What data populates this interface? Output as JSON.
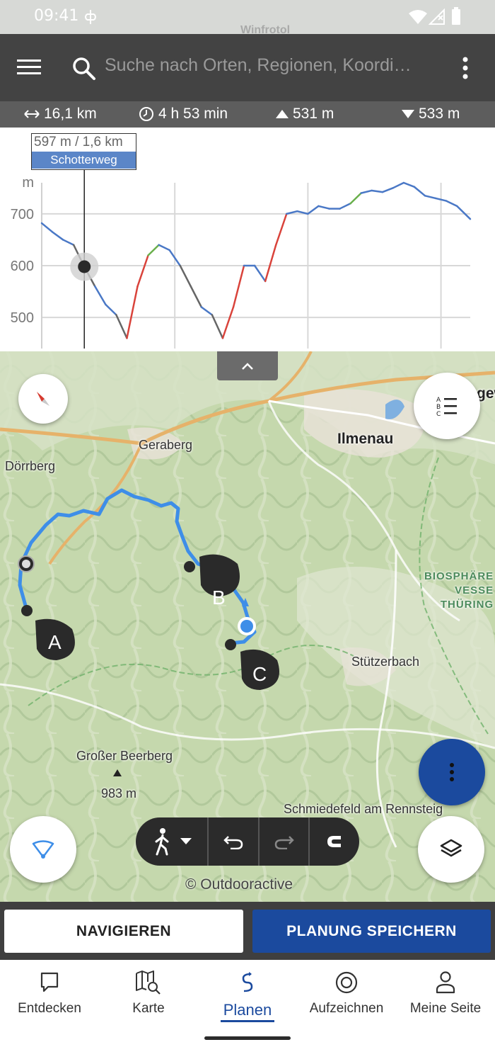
{
  "status_bar": {
    "time": "09:41",
    "behind_text": "Winfrotol"
  },
  "search": {
    "placeholder": "Suche nach Orten, Regionen, Koordi…"
  },
  "stats": {
    "distance": "16,1 km",
    "duration": "4 h 53 min",
    "ascent": "531 m",
    "descent": "533 m"
  },
  "chart_data": {
    "type": "line",
    "ylabel": "m",
    "yticks": [
      500,
      600,
      700
    ],
    "ylim": [
      440,
      760
    ],
    "x": [
      0,
      0.4,
      0.8,
      1.2,
      1.6,
      2.0,
      2.4,
      2.8,
      3.2,
      3.6,
      4.0,
      4.4,
      4.8,
      5.2,
      5.6,
      6.0,
      6.4,
      6.8,
      7.2,
      7.6,
      8.0,
      8.4,
      8.8,
      9.2,
      9.6,
      10.0,
      10.4,
      10.8,
      11.2,
      11.6,
      12.0,
      12.4,
      12.8,
      13.2,
      13.6,
      14.0,
      14.4,
      14.8,
      15.2,
      15.6,
      16.1
    ],
    "values": [
      682,
      665,
      650,
      640,
      598,
      560,
      525,
      505,
      460,
      560,
      620,
      640,
      630,
      600,
      560,
      520,
      505,
      460,
      520,
      600,
      600,
      570,
      640,
      700,
      705,
      700,
      715,
      710,
      710,
      720,
      740,
      745,
      742,
      750,
      760,
      752,
      735,
      730,
      725,
      715,
      690
    ],
    "tooltip": {
      "value": "597 m / 1,6 km",
      "surface": "Schotterweg"
    },
    "cursor_km": 1.6,
    "colors": {
      "default": "#4a78c6",
      "uphill": "#6ab04c",
      "steep": "#d9433b",
      "downhill": "#666666"
    }
  },
  "map": {
    "places": [
      "Geraberg",
      "Ilmenau",
      "Dörrberg",
      "Stützerbach",
      "Großer Beerberg",
      "983 m",
      "Schmiedefeld am Rennsteig"
    ],
    "region": [
      "BIOSPHÄRE",
      "VESSE",
      "THÜRING"
    ],
    "edge_label": "gew",
    "waypoints": [
      "A",
      "B",
      "C"
    ],
    "copyright": "© Outdooractive"
  },
  "actions": {
    "navigate": "NAVIGIEREN",
    "save": "PLANUNG SPEICHERN"
  },
  "nav": [
    {
      "label": "Entdecken",
      "icon": "discover-icon"
    },
    {
      "label": "Karte",
      "icon": "map-search-icon"
    },
    {
      "label": "Planen",
      "icon": "route-icon"
    },
    {
      "label": "Aufzeichnen",
      "icon": "record-icon"
    },
    {
      "label": "Meine Seite",
      "icon": "user-icon"
    }
  ],
  "accent": "#1b4a9e"
}
